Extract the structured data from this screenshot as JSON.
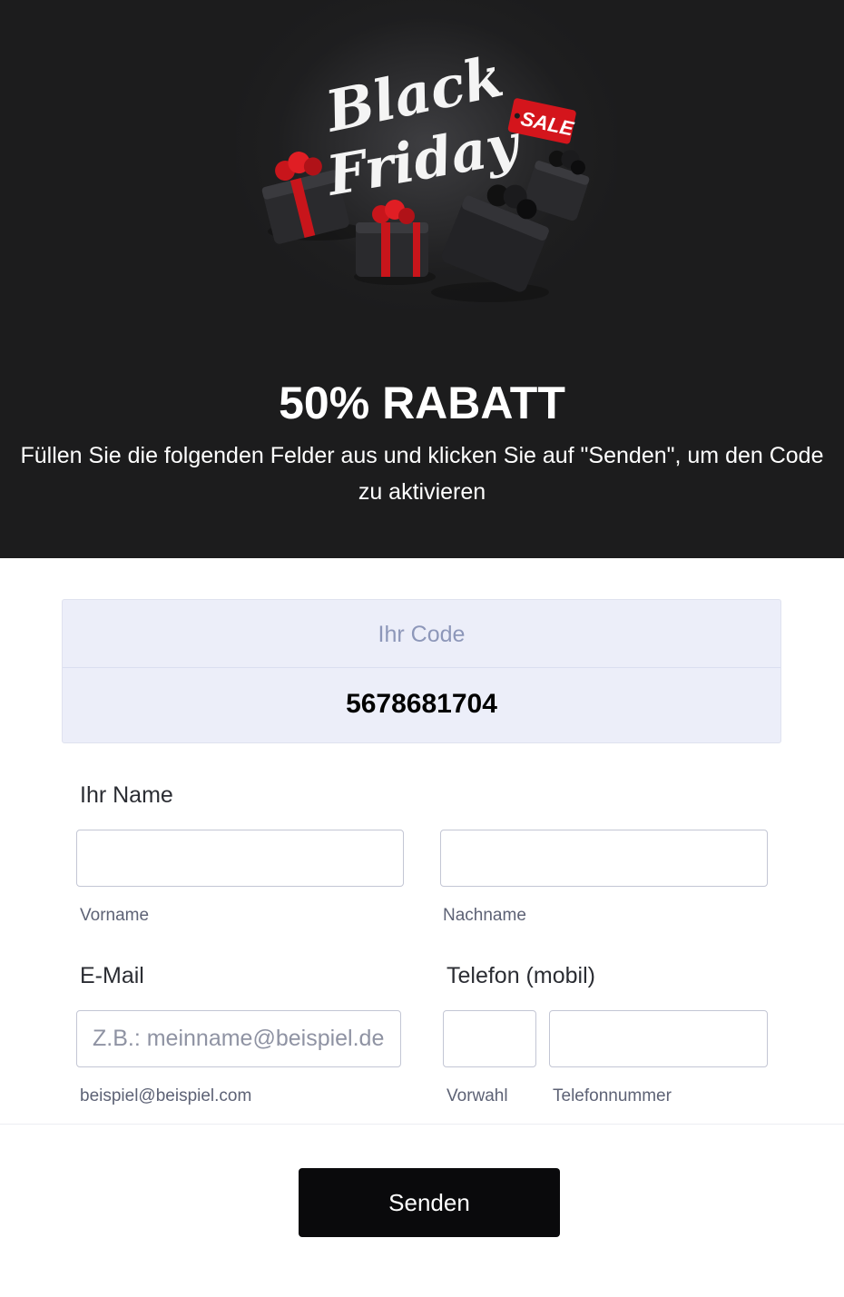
{
  "banner": {
    "logo_line1": "Black",
    "logo_line2": "Friday",
    "sale_tag": "SALE",
    "headline": "50% RABATT",
    "subtext": "Füllen Sie die folgenden Felder aus und klicken Sie auf \"Senden\", um den Code zu aktivieren",
    "colors": {
      "background": "#1c1c1d",
      "accent": "#d4151c"
    }
  },
  "code": {
    "label": "Ihr Code",
    "value": "5678681704"
  },
  "form": {
    "name": {
      "title": "Ihr Name",
      "first_value": "",
      "first_sublabel": "Vorname",
      "last_value": "",
      "last_sublabel": "Nachname"
    },
    "email": {
      "title": "E-Mail",
      "value": "",
      "placeholder": "Z.B.: meinname@beispiel.de",
      "sublabel": "beispiel@beispiel.com"
    },
    "phone": {
      "title": "Telefon (mobil)",
      "area_value": "",
      "area_sublabel": "Vorwahl",
      "number_value": "",
      "number_sublabel": "Telefonnummer"
    },
    "submit_label": "Senden"
  }
}
